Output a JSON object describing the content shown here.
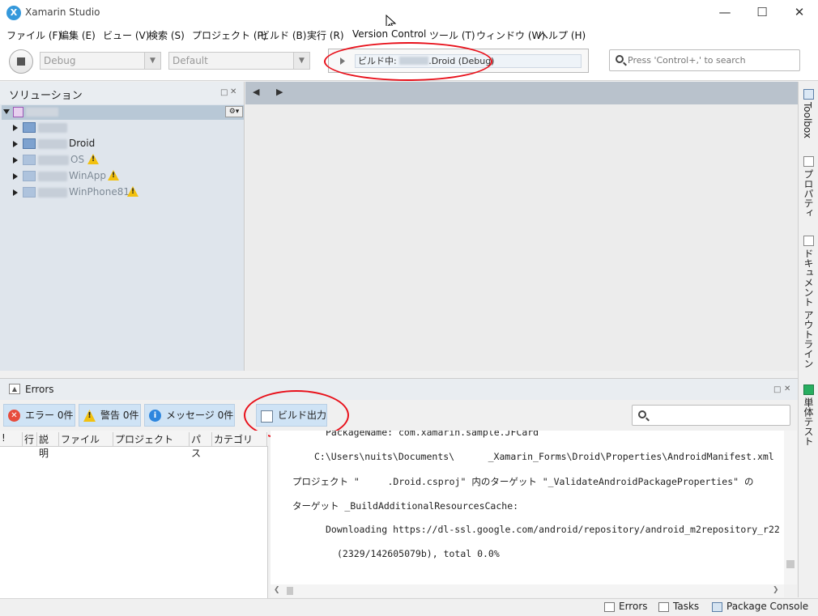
{
  "window": {
    "title": "Xamarin Studio",
    "app_icon": "X"
  },
  "menu": [
    "ファイル (F)",
    "編集 (E)",
    "ビュー (V)",
    "検索 (S)",
    "プロジェクト (P)",
    "ビルド (B)",
    "実行 (R)",
    "Version Control",
    "ツール (T)",
    "ウィンドウ (W)",
    "ヘルプ (H)"
  ],
  "toolbar": {
    "config": "Debug",
    "target": "Default",
    "status_prefix": "ビルド中: ",
    "status_suffix": ".Droid (Debug)",
    "search_placeholder": "Press 'Control+,' to search"
  },
  "solution_pad": {
    "title": "ソリューション",
    "projects": [
      {
        "suffix": "",
        "warning": false,
        "dim": false
      },
      {
        "suffix": "Droid",
        "warning": false,
        "dim": false
      },
      {
        "suffix": "OS",
        "warning": true,
        "dim": true
      },
      {
        "suffix": "WinApp",
        "warning": true,
        "dim": true
      },
      {
        "suffix": "WinPhone81",
        "warning": true,
        "dim": true
      }
    ]
  },
  "right_sidebar": {
    "tabs": [
      "Toolbox",
      "プロパティ",
      "ドキュメント アウトライン",
      "単体テスト"
    ]
  },
  "errors_pad": {
    "title": "Errors",
    "filters": {
      "errors": "エラー 0件",
      "warnings": "警告 0件",
      "messages": "メッセージ 0件",
      "build_output": "ビルド出力"
    },
    "columns": [
      "!",
      "行",
      "説明",
      "ファイル",
      "プロジェクト",
      "パス",
      "カテゴリ"
    ],
    "output_lines": [
      "PackageName: com.xamarin.sample.JFCard",
      "C:\\Users\\nuits\\Documents\\      _Xamarin_Forms\\Droid\\Properties\\AndroidManifest.xml",
      "プロジェクト \"     .Droid.csproj\" 内のターゲット \"_ValidateAndroidPackageProperties\" の",
      "ターゲット _BuildAdditionalResourcesCache:",
      "Downloading https://dl-ssl.google.com/android/repository/android_m2repository_r22",
      "(2329/142605079b), total 0.0%"
    ]
  },
  "statusbar": {
    "errors": "Errors",
    "tasks": "Tasks",
    "package_console": "Package Console"
  },
  "colors": {
    "highlight_oval": "#e8101a",
    "filter_active": "#cfe3f5",
    "selection": "#b8c8d6"
  }
}
